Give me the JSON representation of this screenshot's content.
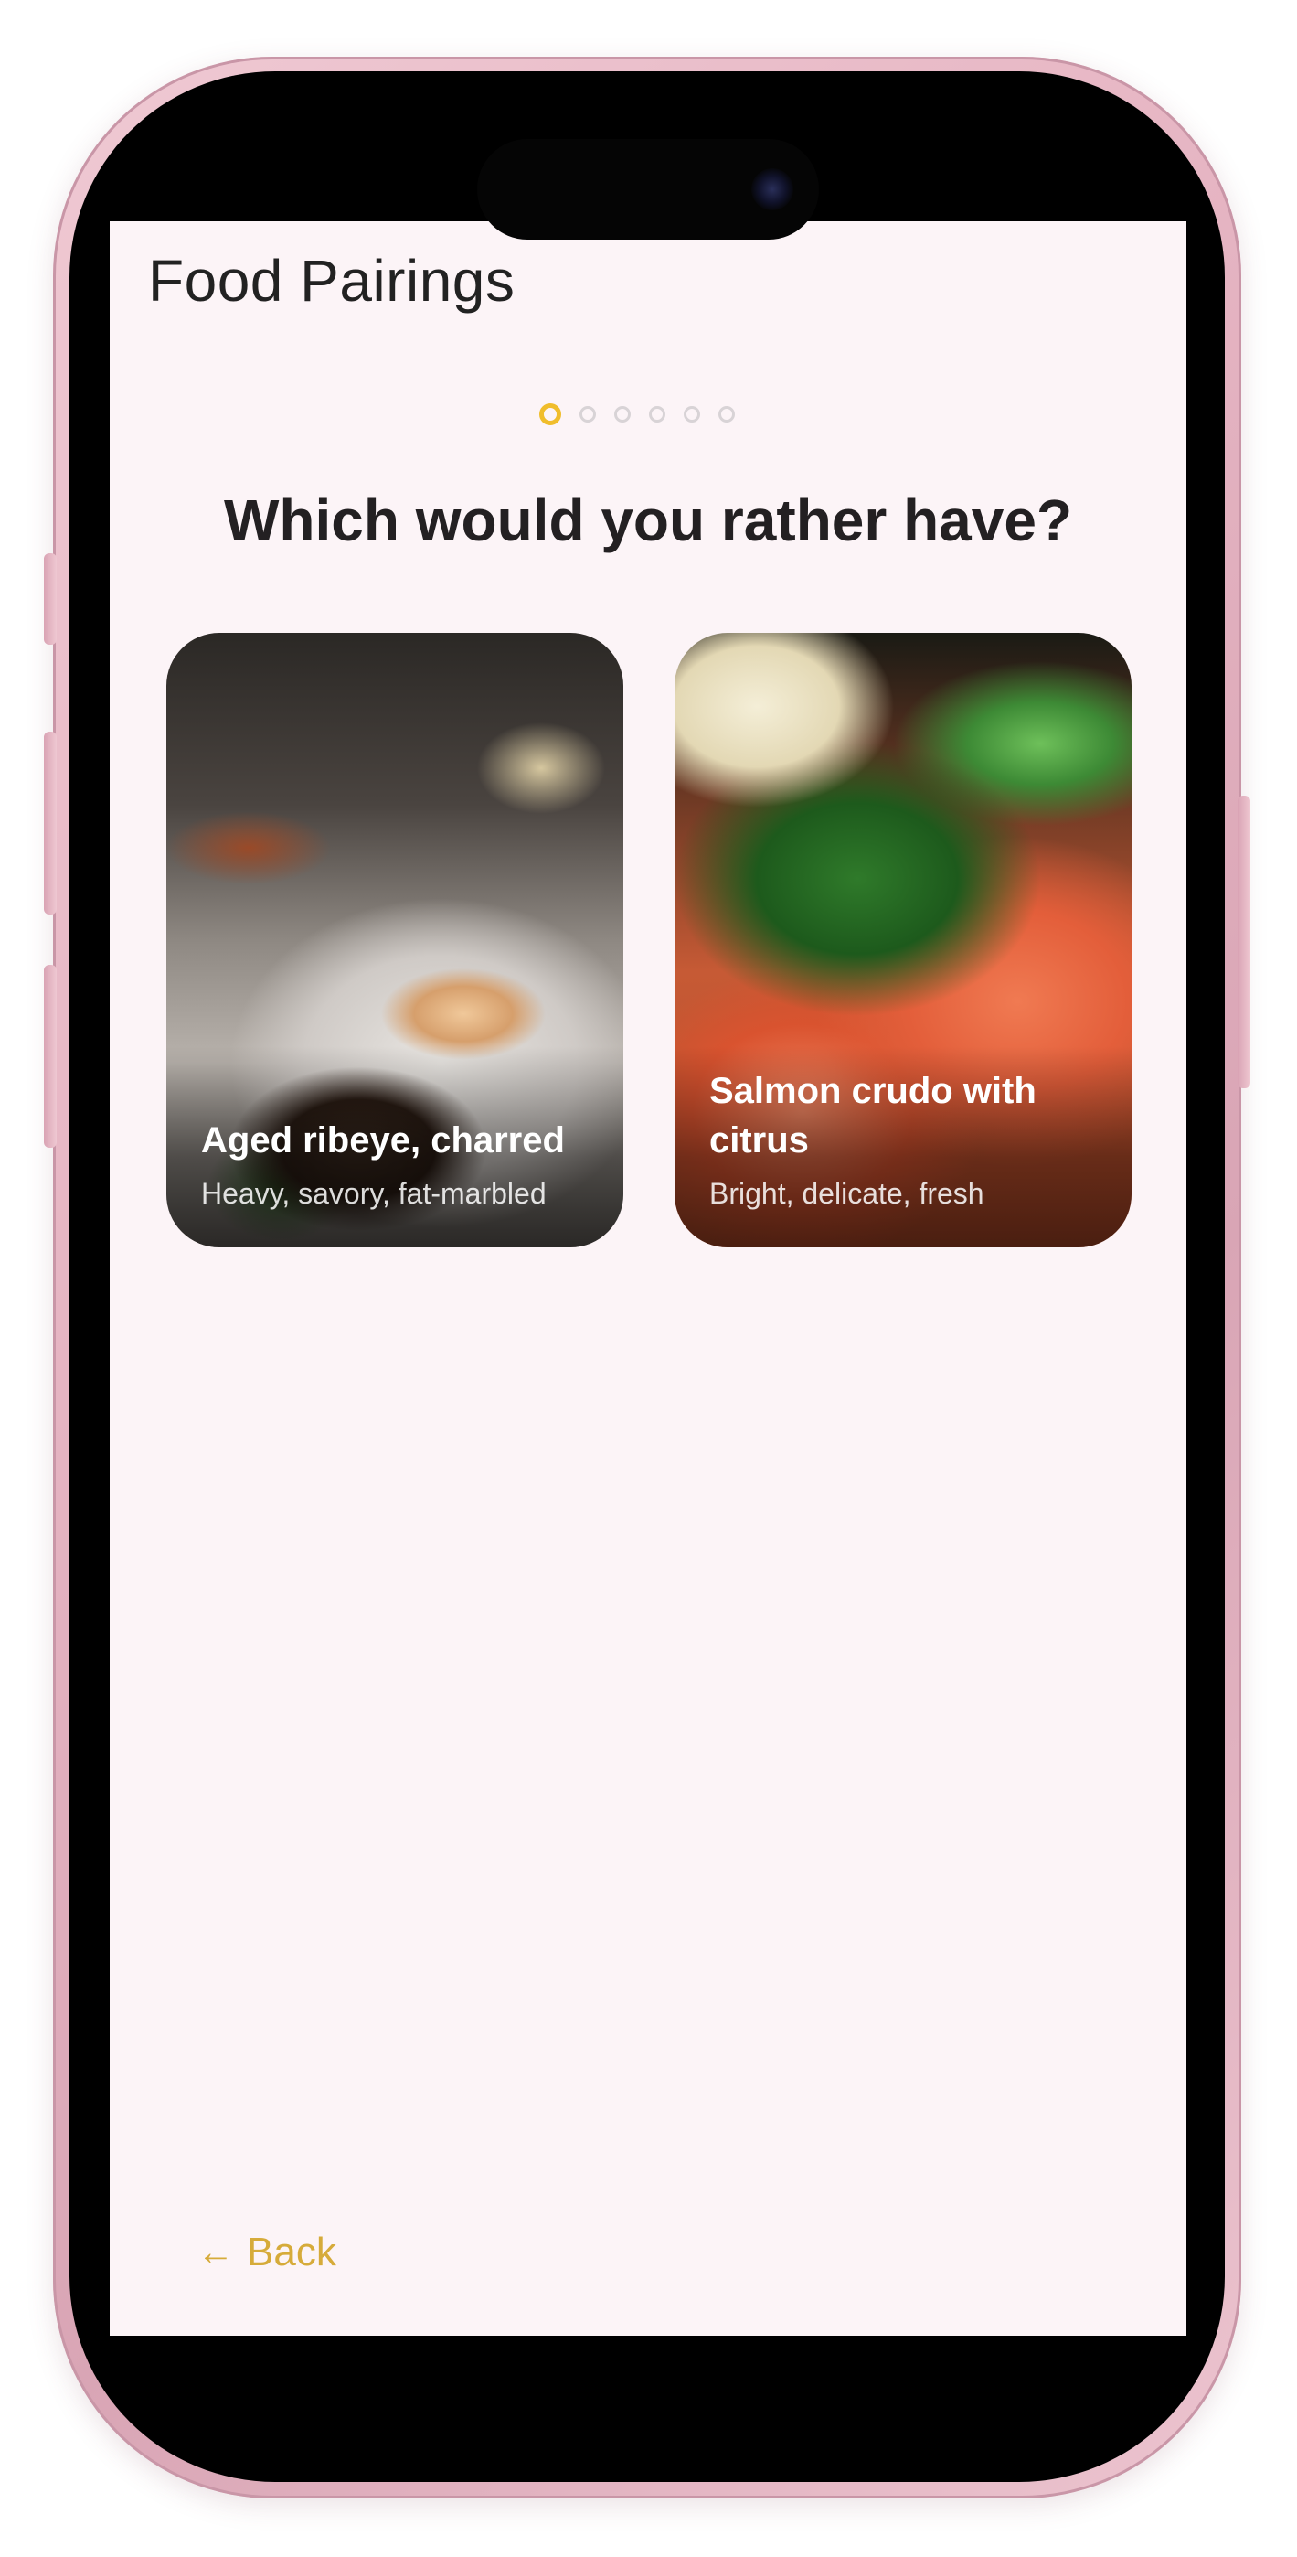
{
  "app": {
    "title": "Food Pairings"
  },
  "progress": {
    "total_steps": 6,
    "current_step": 1
  },
  "question": {
    "text": "Which would you rather have?"
  },
  "options": [
    {
      "title": "Aged ribeye, charred",
      "subtitle": "Heavy, savory, fat-marbled"
    },
    {
      "title": "Salmon crudo with citrus",
      "subtitle": "Bright, delicate, fresh"
    }
  ],
  "footer": {
    "back_label": "Back",
    "back_icon": "←"
  },
  "colors": {
    "accent": "#f0bd2c",
    "back_text": "#d6ab3a",
    "screen_bg": "#fcf4f7",
    "frame": "#e6b5c3"
  }
}
